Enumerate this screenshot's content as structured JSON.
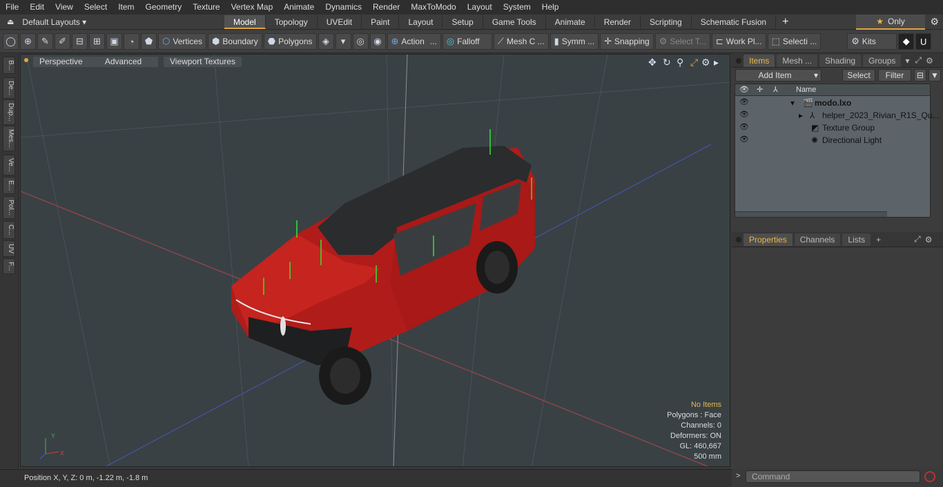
{
  "menu": [
    "File",
    "Edit",
    "View",
    "Select",
    "Item",
    "Geometry",
    "Texture",
    "Vertex Map",
    "Animate",
    "Dynamics",
    "Render",
    "MaxToModo",
    "Layout",
    "System",
    "Help"
  ],
  "layouts_label": "Default Layouts ▾",
  "tabs": [
    "Model",
    "Topology",
    "UVEdit",
    "Paint",
    "Layout",
    "Setup",
    "Game Tools",
    "Animate",
    "Render",
    "Scripting",
    "Schematic Fusion"
  ],
  "active_tab": "Model",
  "only_label": "Only",
  "toolbar": {
    "vertices": "Vertices",
    "boundary": "Boundary",
    "polygons": "Polygons",
    "action": "Action",
    "falloff": "Falloff",
    "mesh_c": "Mesh C ...",
    "symm": "Symm ...",
    "snapping": "Snapping",
    "select_t": "Select T...",
    "work_pl": "Work Pl...",
    "selecti": "Selecti ...",
    "kits": "Kits"
  },
  "left_tabs": [
    "B...",
    "De...",
    "Dup...",
    "Mes...",
    "Ve...",
    "E...",
    "Pol...",
    "C...",
    "UV",
    "F..."
  ],
  "viewport": {
    "perspective": "Perspective",
    "advanced": "Advanced",
    "viewport_textures": "Viewport Textures",
    "stats": {
      "no_items": "No Items",
      "polygons": "Polygons : Face",
      "channels": "Channels: 0",
      "deformers": "Deformers: ON",
      "gl": "GL: 460,667",
      "scale": "500 mm"
    }
  },
  "status": "Position X, Y, Z:   0 m, -1.22 m, -1.8 m",
  "items_panel": {
    "tabs": [
      "Items",
      "Mesh ...",
      "Shading",
      "Groups"
    ],
    "add_item": "Add Item",
    "select": "Select",
    "filter": "Filter",
    "name_header": "Name",
    "rows": [
      "modo.lxo",
      "helper_2023_Rivian_R1S_Qu...",
      "Texture Group",
      "Directional Light"
    ]
  },
  "props_panel": {
    "tabs": [
      "Properties",
      "Channels",
      "Lists"
    ]
  },
  "command_placeholder": "Command",
  "colors": {
    "accent": "#e2a43a",
    "car": "#c0201f",
    "viewport_bg": "#394145"
  }
}
